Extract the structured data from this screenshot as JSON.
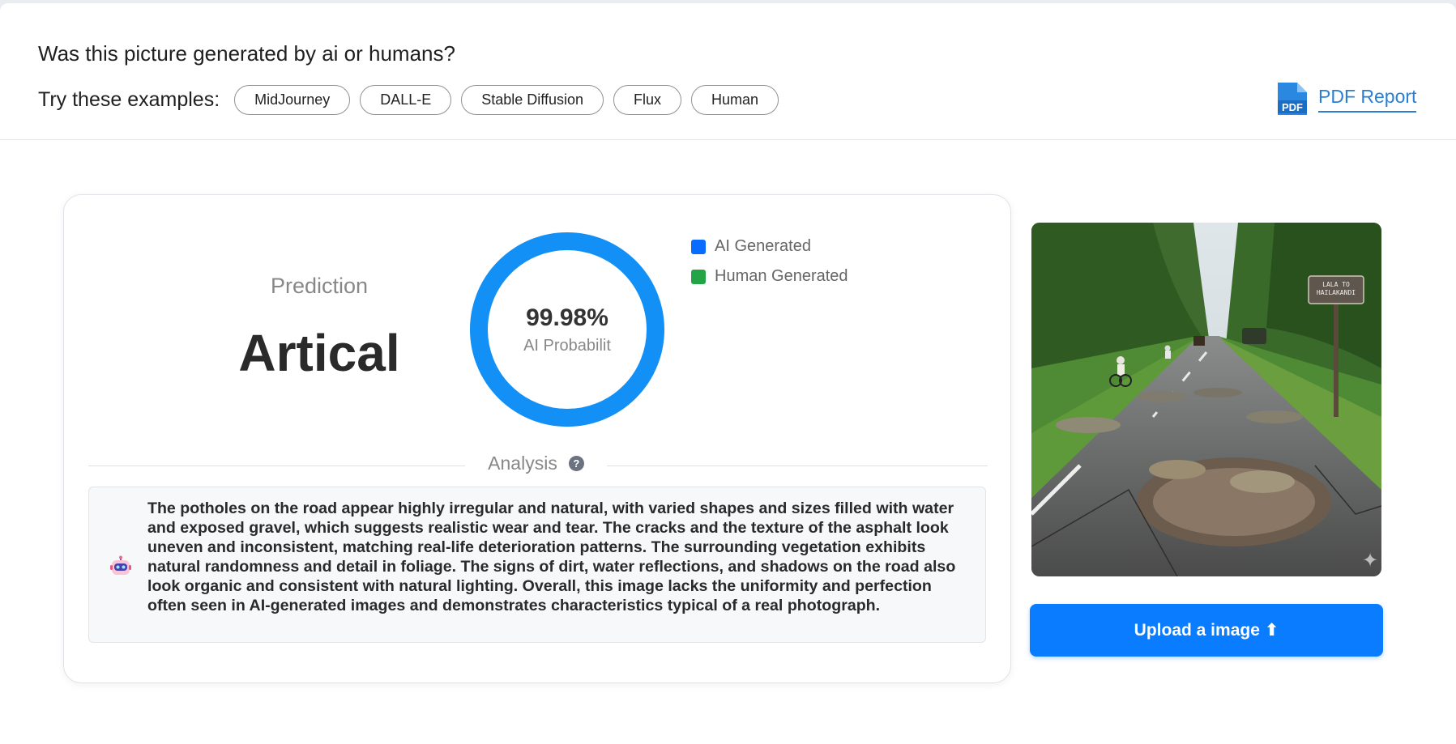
{
  "header": {
    "question": "Was this picture generated by ai or humans?",
    "examples_label": "Try these examples:",
    "examples": [
      "MidJourney",
      "DALL-E",
      "Stable Diffusion",
      "Flux",
      "Human"
    ],
    "pdf_report_label": "PDF Report",
    "pdf_icon_text": "PDF"
  },
  "result": {
    "prediction_label": "Prediction",
    "prediction_value": "Artical",
    "ai_probability": 99.98,
    "ai_probability_text": "99.98%",
    "ai_probability_label": "AI Probabilit",
    "legend": [
      {
        "label": "AI Generated",
        "color": "#0a6cff"
      },
      {
        "label": "Human Generated",
        "color": "#22a447"
      }
    ],
    "donut_color": "#1390f5"
  },
  "analysis": {
    "title": "Analysis",
    "help_icon": "?",
    "text": "The potholes on the road appear highly irregular and natural, with varied shapes and sizes filled with water and exposed gravel, which suggests realistic wear and tear. The cracks and the texture of the asphalt look uneven and inconsistent, matching real-life deterioration patterns. The surrounding vegetation exhibits natural randomness and detail in foliage. The signs of dirt, water reflections, and shadows on the road also look organic and consistent with natural lighting. Overall, this image lacks the uniformity and perfection often seen in AI-generated images and demonstrates characteristics typical of a real photograph."
  },
  "photo": {
    "sign_line1": "LALA TO",
    "sign_line2": "HAILAKANDI"
  },
  "upload": {
    "label": "Upload a image ⬆"
  }
}
